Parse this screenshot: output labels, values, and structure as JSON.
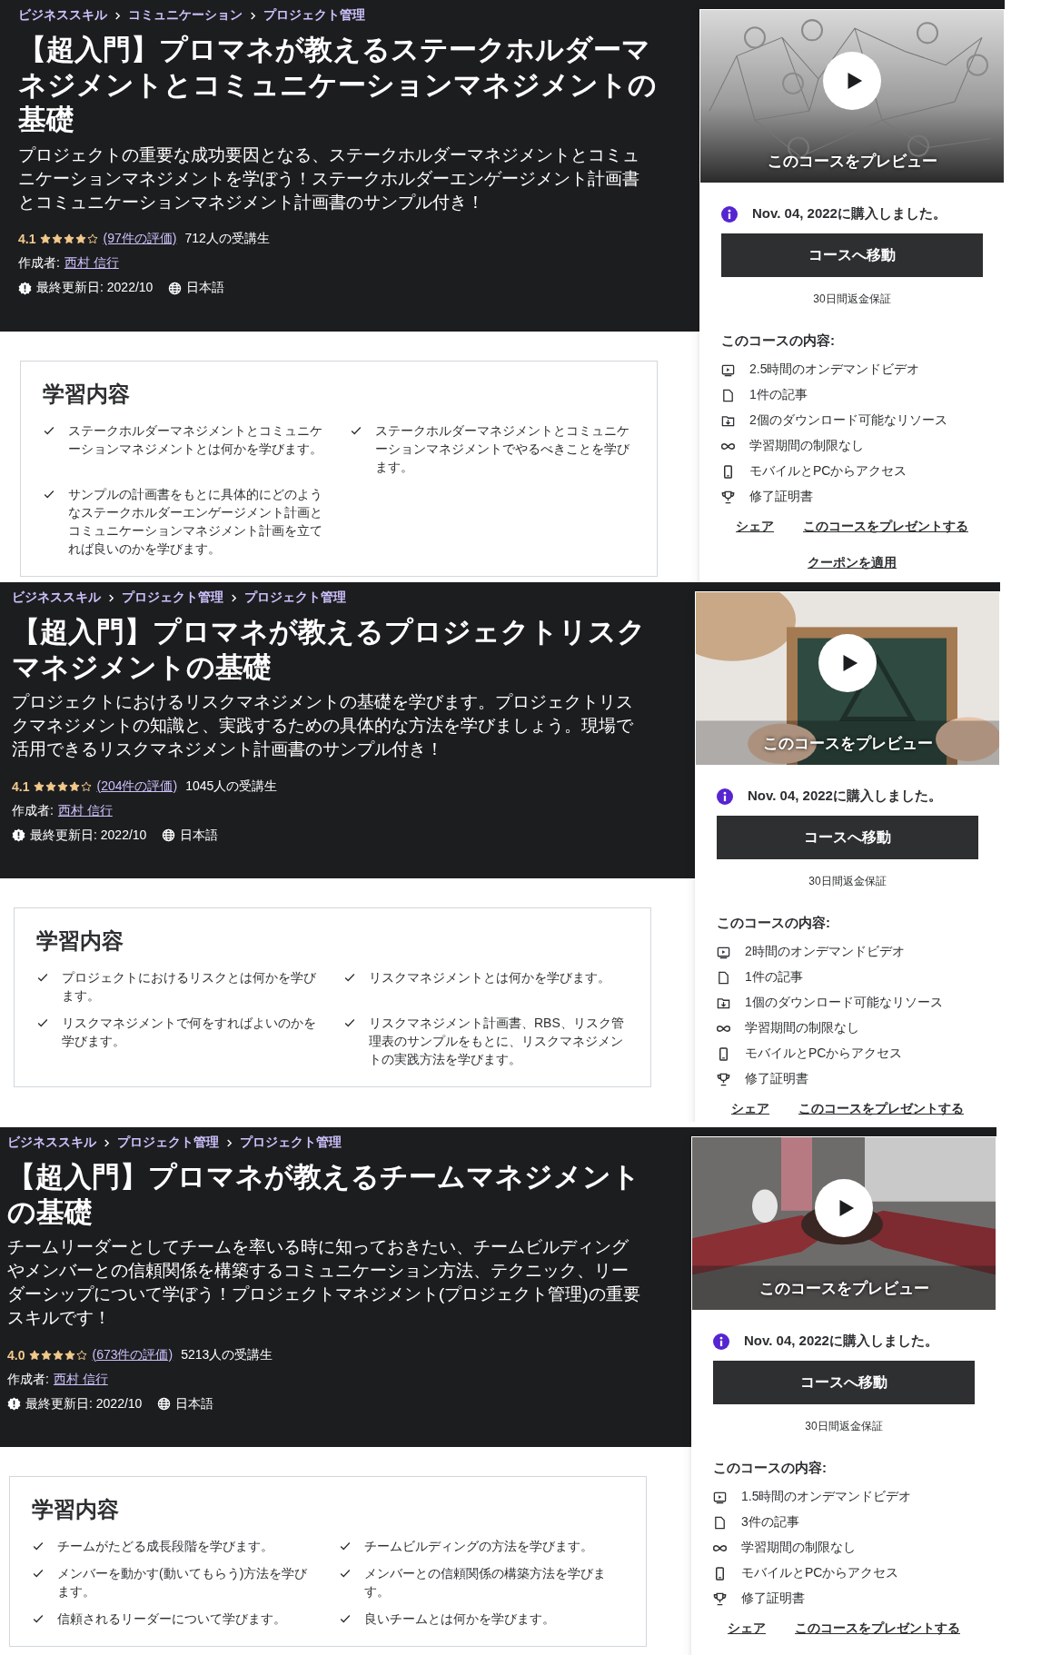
{
  "courses": [
    {
      "breadcrumbs": [
        "ビジネススキル",
        "コミュニケーション",
        "プロジェクト管理"
      ],
      "title": "【超入門】プロマネが教えるステークホルダーマネジメントとコミュニケーションマネジメントの基礎",
      "subtitle": "プロジェクトの重要な成功要因となる、ステークホルダーマネジメントとコミュニケーションマネジメントを学ぼう！ステークホルダーエンゲージメント計画書とコミュニケーションマネジメント計画書のサンプル付き！",
      "rating": {
        "score": "4.1",
        "stars": 4,
        "reviews": "(97件の評価)",
        "students": "712人の受講生"
      },
      "author_label": "作成者:",
      "author": "西村 信行",
      "updated": "最終更新日: 2022/10",
      "language": "日本語",
      "sidebar": {
        "preview": {
          "kind": "picture",
          "label": "このコースをプレビュー"
        },
        "purchased": "Nov. 04, 2022に購入しました。",
        "button": "コースへ移動",
        "guarantee": "30日間返金保証",
        "includes_title": "このコースの内容:",
        "includes": [
          {
            "kind": "video",
            "text": "2.5時間のオンデマンドビデオ"
          },
          {
            "kind": "article",
            "text": "1件の記事"
          },
          {
            "kind": "download",
            "text": "2個のダウンロード可能なリソース"
          },
          {
            "kind": "infinity",
            "text": "学習期間の制限なし"
          },
          {
            "kind": "mobile",
            "text": "モバイルとPCからアクセス"
          },
          {
            "kind": "trophy",
            "text": "修了証明書"
          }
        ],
        "links": [
          "シェア",
          "このコースをプレゼントする"
        ],
        "coupon": "クーポンを適用"
      },
      "learn": {
        "title": "学習内容",
        "items": [
          "ステークホルダーマネジメントとコミュニケーションマネジメントとは何かを学びます。",
          "ステークホルダーマネジメントとコミュニケーションマネジメントでやるべきことを学びます。",
          "サンプルの計画書をもとに具体的にどのようなステークホルダーエンゲージメント計画とコミュニケーションマネジメント計画を立てれば良いのかを学びます。"
        ]
      }
    },
    {
      "breadcrumbs": [
        "ビジネススキル",
        "プロジェクト管理",
        "プロジェクト管理"
      ],
      "title": "【超入門】プロマネが教えるプロジェクトリスクマネジメントの基礎",
      "subtitle": "プロジェクトにおけるリスクマネジメントの基礎を学びます。プロジェクトリスクマネジメントの知識と、実践するための具体的な方法を学びましょう。現場で活用できるリスクマネジメント計画書のサンプル付き！",
      "rating": {
        "score": "4.1",
        "stars": 4,
        "reviews": "(204件の評価)",
        "students": "1045人の受講生"
      },
      "author_label": "作成者:",
      "author": "西村 信行",
      "updated": "最終更新日: 2022/10",
      "language": "日本語",
      "sidebar": {
        "preview": {
          "kind": "picture",
          "label": "このコースをプレビュー"
        },
        "purchased": "Nov. 04, 2022に購入しました。",
        "button": "コースへ移動",
        "guarantee": "30日間返金保証",
        "includes_title": "このコースの内容:",
        "includes": [
          {
            "kind": "video",
            "text": "2時間のオンデマンドビデオ"
          },
          {
            "kind": "article",
            "text": "1件の記事"
          },
          {
            "kind": "download",
            "text": "1個のダウンロード可能なリソース"
          },
          {
            "kind": "infinity",
            "text": "学習期間の制限なし"
          },
          {
            "kind": "mobile",
            "text": "モバイルとPCからアクセス"
          },
          {
            "kind": "trophy",
            "text": "修了証明書"
          }
        ],
        "links": [
          "シェア",
          "このコースをプレゼントする"
        ]
      },
      "learn": {
        "title": "学習内容",
        "items": [
          "プロジェクトにおけるリスクとは何かを学びます。",
          "リスクマネジメントとは何かを学びます。",
          "リスクマネジメントで何をすればよいのかを学びます。",
          "リスクマネジメント計画書、RBS、リスク管理表のサンプルをもとに、リスクマネジメントの実践方法を学びます。"
        ]
      }
    },
    {
      "breadcrumbs": [
        "ビジネススキル",
        "プロジェクト管理",
        "プロジェクト管理"
      ],
      "title": "【超入門】プロマネが教えるチームマネジメントの基礎",
      "subtitle": "チームリーダーとしてチームを率いる時に知っておきたい、チームビルディングやメンバーとの信頼関係を構築するコミュニケーション方法、テクニック、リーダーシップについて学ぼう！プロジェクトマネジメント(プロジェクト管理)の重要スキルです！",
      "rating": {
        "score": "4.0",
        "stars": 4,
        "reviews": "(673件の評価)",
        "students": "5213人の受講生"
      },
      "author_label": "作成者:",
      "author": "西村 信行",
      "updated": "最終更新日: 2022/10",
      "language": "日本語",
      "sidebar": {
        "preview": {
          "kind": "picture",
          "label": "このコースをプレビュー"
        },
        "purchased": "Nov. 04, 2022に購入しました。",
        "button": "コースへ移動",
        "guarantee": "30日間返金保証",
        "includes_title": "このコースの内容:",
        "includes": [
          {
            "kind": "video",
            "text": "1.5時間のオンデマンドビデオ"
          },
          {
            "kind": "article",
            "text": "3件の記事"
          },
          {
            "kind": "infinity",
            "text": "学習期間の制限なし"
          },
          {
            "kind": "mobile",
            "text": "モバイルとPCからアクセス"
          },
          {
            "kind": "trophy",
            "text": "修了証明書"
          }
        ],
        "links": [
          "シェア",
          "このコースをプレゼントする"
        ]
      },
      "learn": {
        "title": "学習内容",
        "items": [
          "チームがたどる成長段階を学びます。",
          "チームビルディングの方法を学びます。",
          "メンバーを動かす(動いてもらう)方法を学びます。",
          "メンバーとの信頼関係の構築方法を学びます。",
          "信頼されるリーダーについて学びます。",
          "良いチームとは何かを学びます。"
        ]
      }
    }
  ]
}
